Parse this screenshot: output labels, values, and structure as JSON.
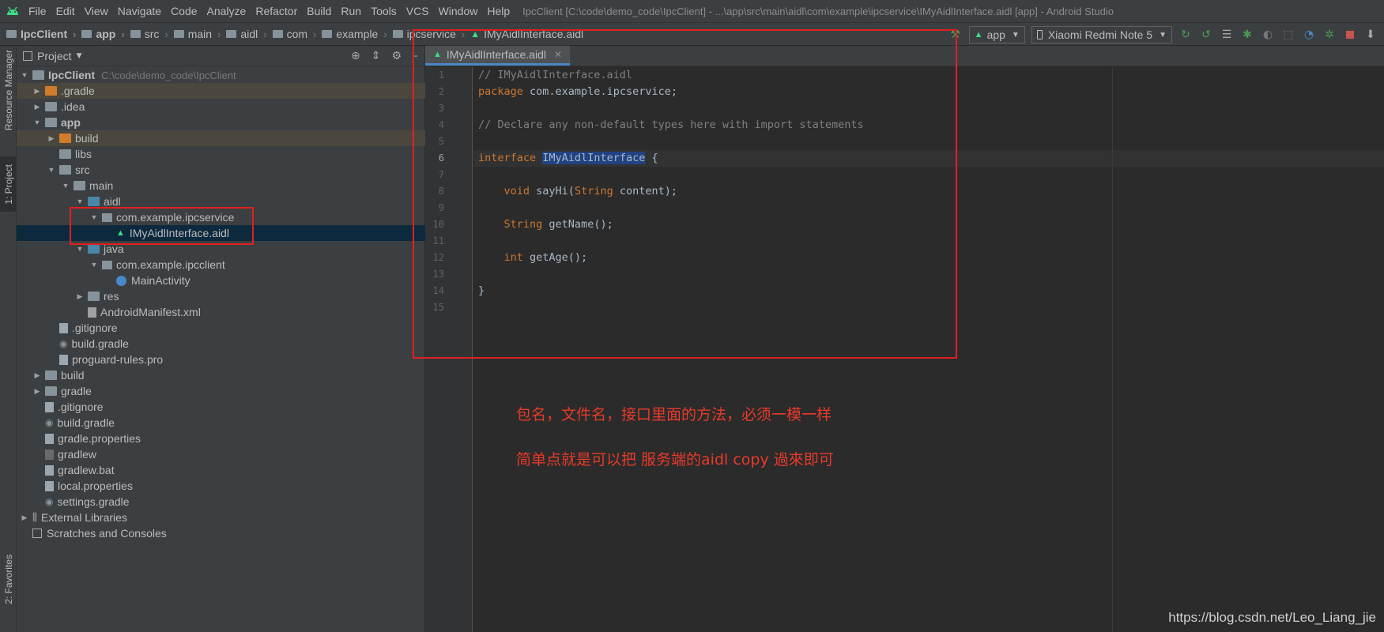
{
  "menubar": {
    "items": [
      "File",
      "Edit",
      "View",
      "Navigate",
      "Code",
      "Analyze",
      "Refactor",
      "Build",
      "Run",
      "Tools",
      "VCS",
      "Window",
      "Help"
    ],
    "title": "IpcClient [C:\\code\\demo_code\\IpcClient] - ...\\app\\src\\main\\aidl\\com\\example\\ipcservice\\IMyAidlInterface.aidl [app] - Android Studio"
  },
  "breadcrumbs": [
    "IpcClient",
    "app",
    "src",
    "main",
    "aidl",
    "com",
    "example",
    "ipcservice",
    "IMyAidlInterface.aidl"
  ],
  "toolbar": {
    "run_config": "app",
    "device": "Xiaomi Redmi Note 5"
  },
  "side_tabs": {
    "resource_manager": "Resource Manager",
    "project": "1: Project",
    "favorites": "2: Favorites"
  },
  "project_panel": {
    "title": "Project",
    "tree": [
      {
        "label": "IpcClient",
        "path": "C:\\code\\demo_code\\IpcClient"
      },
      {
        "label": ".gradle"
      },
      {
        "label": ".idea"
      },
      {
        "label": "app"
      },
      {
        "label": "build"
      },
      {
        "label": "libs"
      },
      {
        "label": "src"
      },
      {
        "label": "main"
      },
      {
        "label": "aidl"
      },
      {
        "label": "com.example.ipcservice"
      },
      {
        "label": "IMyAidlInterface.aidl"
      },
      {
        "label": "java"
      },
      {
        "label": "com.example.ipcclient"
      },
      {
        "label": "MainActivity"
      },
      {
        "label": "res"
      },
      {
        "label": "AndroidManifest.xml"
      },
      {
        "label": ".gitignore"
      },
      {
        "label": "build.gradle"
      },
      {
        "label": "proguard-rules.pro"
      },
      {
        "label": "build"
      },
      {
        "label": "gradle"
      },
      {
        "label": ".gitignore"
      },
      {
        "label": "build.gradle"
      },
      {
        "label": "gradle.properties"
      },
      {
        "label": "gradlew"
      },
      {
        "label": "gradlew.bat"
      },
      {
        "label": "local.properties"
      },
      {
        "label": "settings.gradle"
      },
      {
        "label": "External Libraries"
      },
      {
        "label": "Scratches and Consoles"
      }
    ]
  },
  "editor": {
    "tab_label": "IMyAidlInterface.aidl",
    "current_line": "6",
    "line_numbers": [
      "1",
      "2",
      "3",
      "4",
      "5",
      "6",
      "7",
      "8",
      "9",
      "10",
      "11",
      "12",
      "13",
      "14",
      "15"
    ],
    "code": {
      "l1": "// IMyAidlInterface.aidl",
      "l2_kw": "package",
      "l2_rest": " com.example.ipcservice;",
      "l4": "// Declare any non-default types here with import statements",
      "l6_kw": "interface",
      "l6_name": "IMyAidlInterface",
      "l6_rest": " {",
      "l8_kw": "void",
      "l8_rest": " sayHi(",
      "l8_type": "String",
      "l8_end": " content);",
      "l10_type": "String",
      "l10_rest": " getName();",
      "l12_kw": "int",
      "l12_rest": " getAge();",
      "l14": "}"
    }
  },
  "annotations": {
    "note1": "包名，文件名，接口里面的方法，必须一模一样",
    "note2": "简单点就是可以把 服务端的aidl copy 過來即可",
    "color": "#e02020"
  },
  "watermark": "https://blog.csdn.net/Leo_Liang_jie"
}
